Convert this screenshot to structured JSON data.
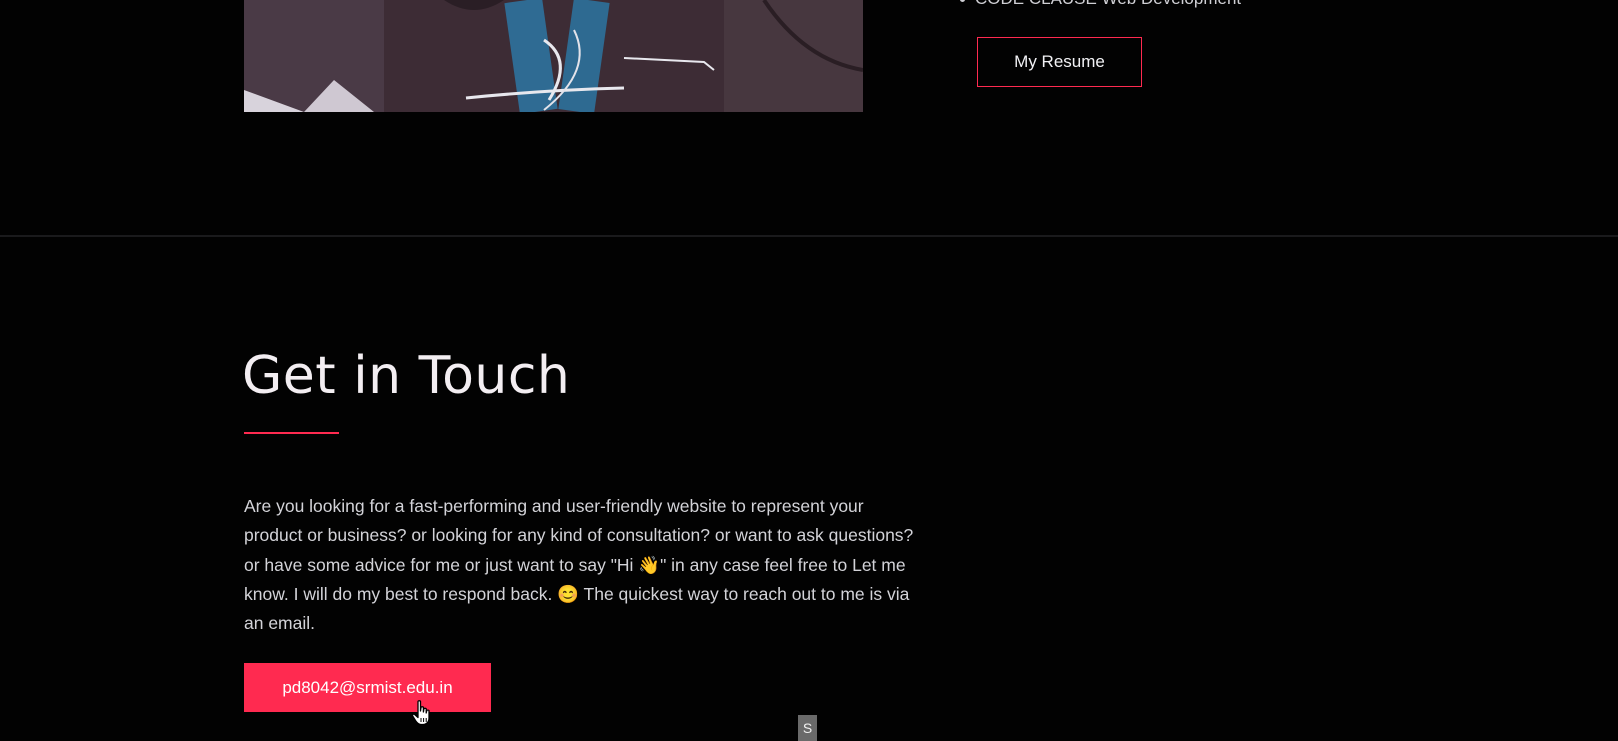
{
  "about": {
    "bullet_item": "CODE CLAUSE Web Development",
    "resume_label": "My Resume"
  },
  "contact": {
    "title": "Get in Touch",
    "description": "Are you looking for a fast-performing and user-friendly website to represent your product or business? or looking for any kind of consultation? or want to ask questions? or have some advice for me or just want to say \"Hi 👋\" in any case feel free to Let me know. I will do my best to respond back. 😊 The quickest way to reach out to me is via an email.",
    "email": "pd8042@srmist.edu.in"
  },
  "floating_tag": {
    "label": "S"
  },
  "colors": {
    "background": "#020202",
    "accent": "#ff2a50",
    "text": "#d3d3d8"
  },
  "icons": {
    "cursor": "hand-pointer-icon",
    "bullet": "bullet-dot-icon"
  }
}
